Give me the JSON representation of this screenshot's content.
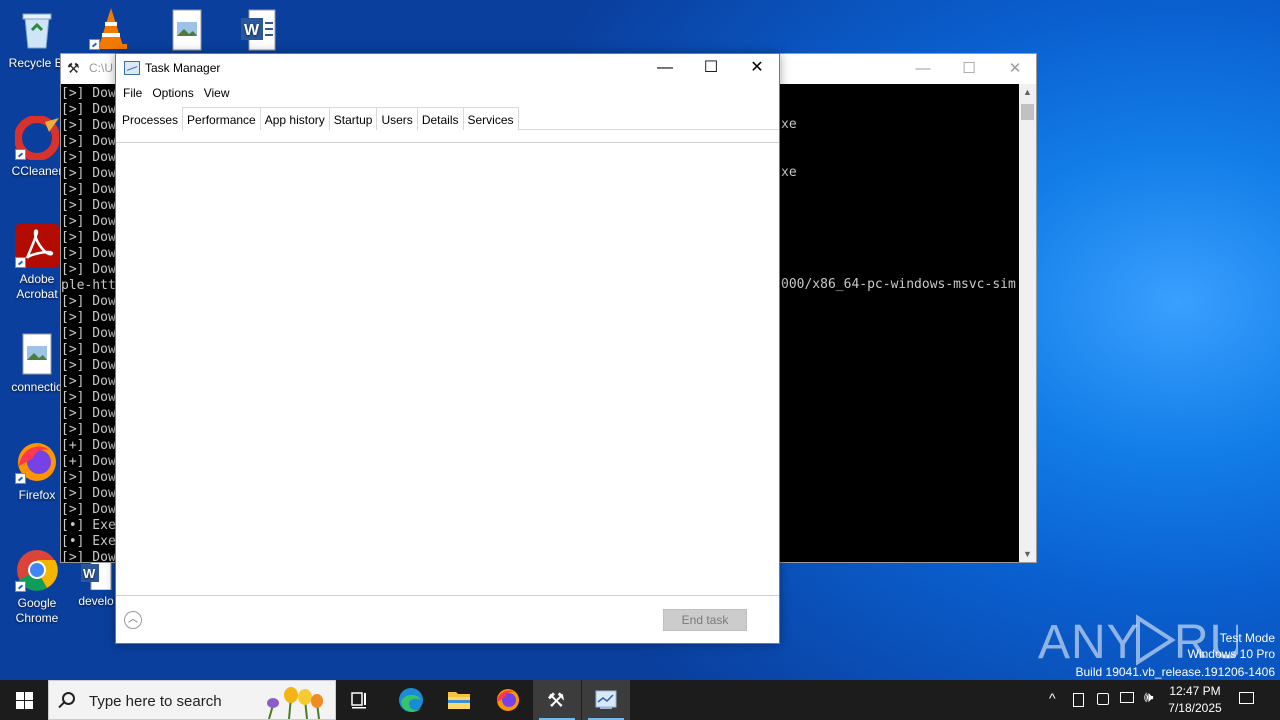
{
  "desktop": {
    "icons": [
      {
        "label": "Recycle Bi",
        "x_name": "recycle-bin"
      },
      {
        "label": "CCleaner"
      },
      {
        "label": "Adobe Acrobat"
      },
      {
        "label": "connectio"
      },
      {
        "label": "Firefox"
      },
      {
        "label": "Google Chrome"
      },
      {
        "label": "develo"
      }
    ]
  },
  "console_left": {
    "title": "C:\\U",
    "lines": [
      "[>] Dow",
      "[>] Dow",
      "[>] Dow",
      "[>] Dow",
      "[>] Dow",
      "[>] Dow",
      "[>] Dow",
      "[>] Dow",
      "[>] Dow",
      "[>] Dow",
      "[>] Dow",
      "[>] Dow",
      "ple-htt",
      "[>] Dow",
      "[>] Dow",
      "[>] Dow",
      "[>] Dow",
      "[>] Dow",
      "[>] Dow",
      "[>] Dow",
      "[>] Dow",
      "[>] Dow",
      "[+] Dow",
      "[+] Dow",
      "[>] Dow",
      "[>] Dow",
      "[>] Dow",
      "[•] Exe",
      "[•] Exe",
      "[>] Dow"
    ]
  },
  "console_right": {
    "lines": [
      {
        "row": 1,
        "text": "xe"
      },
      {
        "row": 4,
        "text": "xe"
      },
      {
        "row": 11,
        "text": "000/x86_64-pc-windows-msvc-sim"
      }
    ]
  },
  "task_manager": {
    "title": "Task Manager",
    "menu": [
      "File",
      "Options",
      "View"
    ],
    "tabs": [
      "Processes",
      "Performance",
      "App history",
      "Startup",
      "Users",
      "Details",
      "Services"
    ],
    "active_tab": "Processes",
    "end_task_label": "End task"
  },
  "taskbar": {
    "search_placeholder": "Type here to search",
    "time": "12:47 PM",
    "date": "7/18/2025"
  },
  "watermark": {
    "line1": "Test Mode",
    "line2": "Windows 10 Pro",
    "line3": "Build 19041.vb_release.191206-1406",
    "brand": "ANY RUN"
  }
}
